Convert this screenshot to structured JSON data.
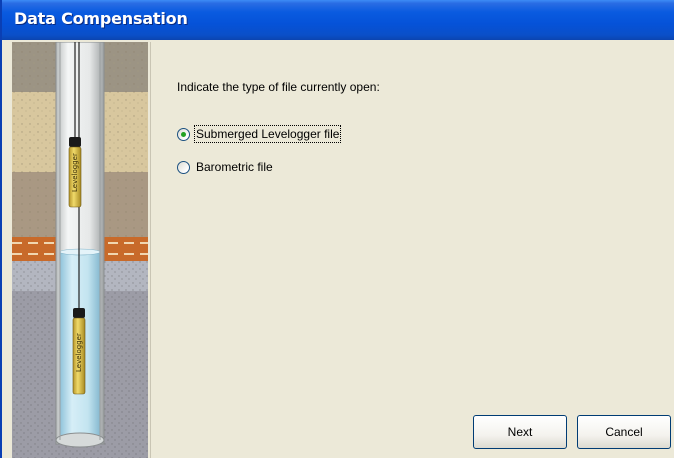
{
  "window": {
    "title": "Data Compensation"
  },
  "content": {
    "prompt": "Indicate the type of file currently open:",
    "options": [
      {
        "label": "Submerged Levelogger file",
        "selected": true
      },
      {
        "label": "Barometric file",
        "selected": false
      }
    ]
  },
  "buttons": {
    "next": "Next",
    "cancel": "Cancel"
  },
  "illustration": {
    "logger_label": "Levelogger",
    "colors": {
      "water": "#bfe1ee",
      "casing": "#e8eaea",
      "clay": "#c86a2a",
      "logger": "#e4c84a"
    }
  }
}
